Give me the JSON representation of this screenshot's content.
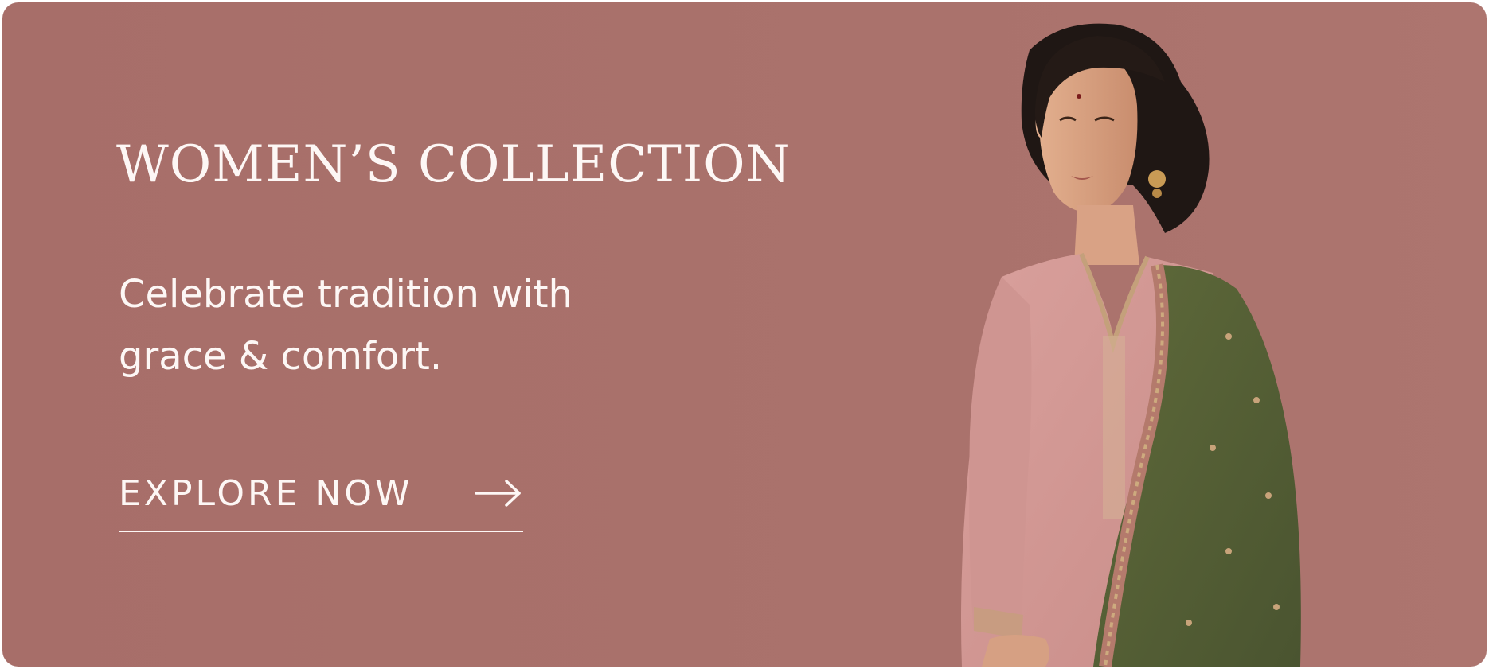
{
  "banner": {
    "title": "WOMEN’S COLLECTION",
    "subtitle_line1": "Celebrate tradition with",
    "subtitle_line2": "grace & comfort.",
    "cta_label": "EXPLORE NOW",
    "cta_icon": "arrow-right-icon",
    "background_color": "#a9716b",
    "text_color": "#fdf7f5",
    "image": "woman-in-pink-kurta-with-green-dupatta"
  }
}
